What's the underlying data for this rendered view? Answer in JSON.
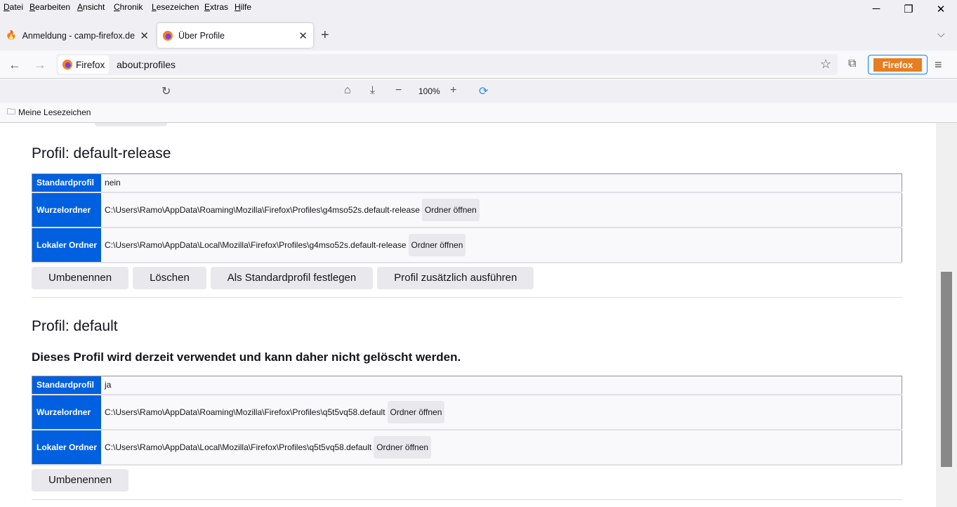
{
  "menu": [
    "Datei",
    "Bearbeiten",
    "Ansicht",
    "Chronik",
    "Lesezeichen",
    "Extras",
    "Hilfe"
  ],
  "window_controls": {
    "minimize": "─",
    "restore": "❐",
    "close": "✕"
  },
  "tabs": [
    {
      "title": "Anmeldung - camp-firefox.de",
      "icon": "flame-icon"
    },
    {
      "title": "Über Profile",
      "icon": "firefox-icon",
      "active": true
    }
  ],
  "navbar": {
    "identity": "Firefox",
    "url": "about:profiles",
    "firefox_button": "Firefox"
  },
  "toolbar": {
    "zoom": "100%"
  },
  "bookmarks": {
    "folder": "Meine Lesezeichen"
  },
  "profiles": [
    {
      "title": "Profil: default-release",
      "note": "",
      "rows": [
        {
          "label": "Standardprofil",
          "value": "nein"
        },
        {
          "label": "Wurzelordner",
          "value": "C:\\Users\\Ramo\\AppData\\Roaming\\Mozilla\\Firefox\\Profiles\\g4mso52s.default-release",
          "button": "Ordner öffnen"
        },
        {
          "label": "Lokaler Ordner",
          "value": "C:\\Users\\Ramo\\AppData\\Local\\Mozilla\\Firefox\\Profiles\\g4mso52s.default-release",
          "button": "Ordner öffnen"
        }
      ],
      "actions": [
        "Umbenennen",
        "Löschen",
        "Als Standardprofil festlegen",
        "Profil zusätzlich ausführen"
      ]
    },
    {
      "title": "Profil: default",
      "note": "Dieses Profil wird derzeit verwendet und kann daher nicht gelöscht werden.",
      "rows": [
        {
          "label": "Standardprofil",
          "value": "ja"
        },
        {
          "label": "Wurzelordner",
          "value": "C:\\Users\\Ramo\\AppData\\Roaming\\Mozilla\\Firefox\\Profiles\\q5t5vq58.default",
          "button": "Ordner öffnen"
        },
        {
          "label": "Lokaler Ordner",
          "value": "C:\\Users\\Ramo\\AppData\\Local\\Mozilla\\Firefox\\Profiles\\q5t5vq58.default",
          "button": "Ordner öffnen"
        }
      ],
      "actions": [
        "Umbenennen"
      ]
    }
  ]
}
